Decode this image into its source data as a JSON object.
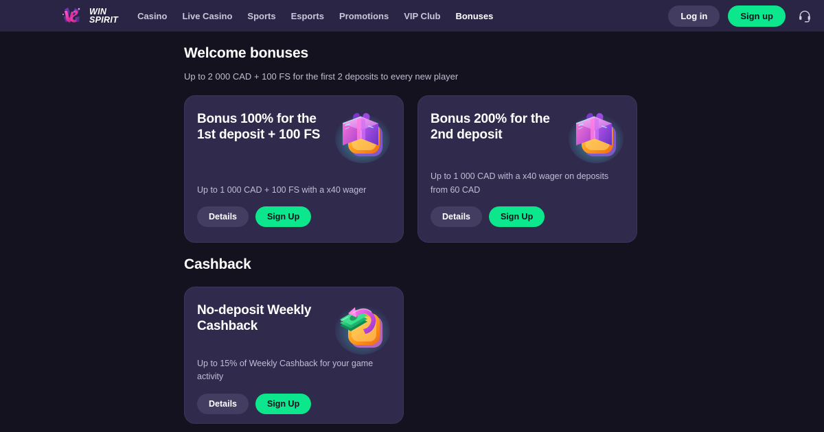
{
  "brand": {
    "name_line1": "WIN",
    "name_line2": "SPIRIT",
    "logo_icon": "ws-monogram-icon",
    "accent_green": "#0ce78d",
    "accent_pink": "#e045c0",
    "header_bg": "#2a2545",
    "page_bg": "#14121e",
    "card_bg": "#302a4d"
  },
  "nav": {
    "items": [
      {
        "label": "Casino",
        "active": false
      },
      {
        "label": "Live Casino",
        "active": false
      },
      {
        "label": "Sports",
        "active": false
      },
      {
        "label": "Esports",
        "active": false
      },
      {
        "label": "Promotions",
        "active": false
      },
      {
        "label": "VIP Club",
        "active": false
      },
      {
        "label": "Bonuses",
        "active": true
      }
    ]
  },
  "header_actions": {
    "login_label": "Log in",
    "signup_label": "Sign up",
    "support_icon": "headset-icon"
  },
  "sections": [
    {
      "title": "Welcome bonuses",
      "subtitle": "Up to 2 000 CAD + 100 FS for the first 2 deposits to every new player",
      "cards": [
        {
          "title": "Bonus 100% for the 1st deposit + 100 FS",
          "description": "Up to 1 000 CAD + 100 FS with a x40 wager",
          "icon": "gift-box-icon",
          "details_label": "Details",
          "signup_label": "Sign Up"
        },
        {
          "title": "Bonus 200% for the 2nd deposit",
          "description": "Up to 1 000 CAD with a x40 wager on deposits from 60 CAD",
          "icon": "gift-box-icon",
          "details_label": "Details",
          "signup_label": "Sign Up"
        }
      ]
    },
    {
      "title": "Cashback",
      "subtitle": "",
      "cards": [
        {
          "title": "No-deposit Weekly Cashback",
          "description": "Up to 15% of Weekly Cashback for your game activity",
          "icon": "cashback-money-icon",
          "details_label": "Details",
          "signup_label": "Sign Up"
        }
      ]
    }
  ]
}
